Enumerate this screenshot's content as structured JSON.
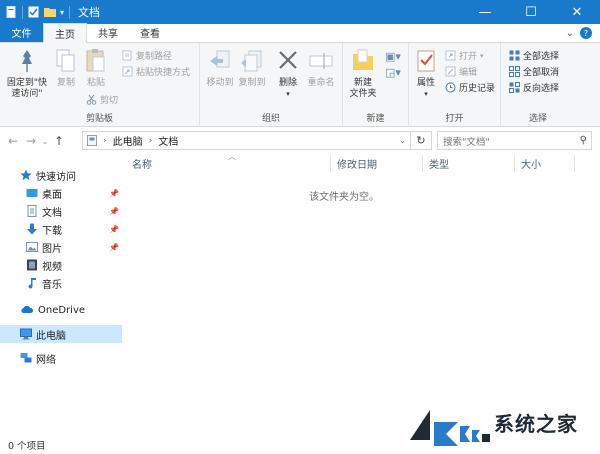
{
  "titlebar": {
    "title": "文档",
    "controls": {
      "minimize": "—",
      "maximize": "☐",
      "close": "✕"
    }
  },
  "ribbon_tabs": [
    {
      "label": "文件"
    },
    {
      "label": "主页"
    },
    {
      "label": "共享"
    },
    {
      "label": "查看"
    }
  ],
  "ribbon": {
    "clipboard": {
      "group_label": "剪贴板",
      "pin_quick_access": "固定到\"快\n速访问\"",
      "copy": "复制",
      "paste": "粘贴",
      "copy_path": "复制路径",
      "paste_shortcut": "粘贴快捷方式",
      "cut": "剪切"
    },
    "organize": {
      "group_label": "组织",
      "move_to": "移动到",
      "copy_to": "复制到",
      "delete": "删除",
      "rename": "重命名"
    },
    "new": {
      "group_label": "新建",
      "new_folder": "新建\n文件夹"
    },
    "open": {
      "group_label": "打开",
      "properties": "属性",
      "open": "打开",
      "edit": "编辑",
      "history": "历史记录"
    },
    "select": {
      "group_label": "选择",
      "select_all": "全部选择",
      "select_none": "全部取消",
      "invert": "反向选择"
    }
  },
  "address": {
    "crumbs": [
      "此电脑",
      "文档"
    ],
    "search_placeholder": "搜索\"文档\""
  },
  "navpane": {
    "quick_access": "快速访问",
    "items": [
      {
        "label": "桌面"
      },
      {
        "label": "文档"
      },
      {
        "label": "下载"
      },
      {
        "label": "图片"
      },
      {
        "label": "视频"
      },
      {
        "label": "音乐"
      }
    ],
    "onedrive": "OneDrive",
    "this_pc": "此电脑",
    "network": "网络"
  },
  "columns": [
    "名称",
    "修改日期",
    "类型",
    "大小"
  ],
  "empty_message": "该文件夹为空。",
  "status": "0 个项目",
  "watermark": "系统之家",
  "colors": {
    "accent": "#1979ca",
    "selected": "#cce8ff",
    "ribbon_bg": "#f5f6f7"
  }
}
